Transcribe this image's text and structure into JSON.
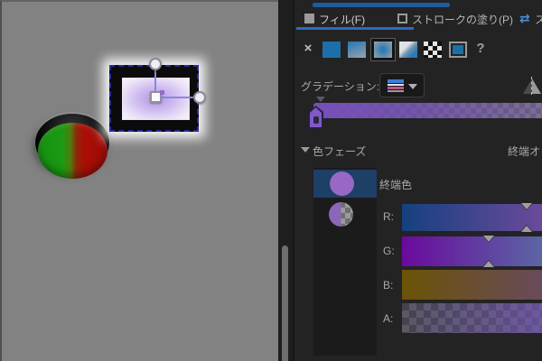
{
  "panel": {
    "tabs": [
      {
        "label": "フィル(F)",
        "active": true
      },
      {
        "label": "ストロークの塗り(P)",
        "active": false
      },
      {
        "label": "ス",
        "active": false
      }
    ],
    "fill_types": {
      "none_label": "×",
      "help_label": "?",
      "selected": "radial-gradient",
      "accent_blue": "#1e6fa8"
    },
    "gradient": {
      "label": "グラデーション:",
      "bar_start": "#7650bb",
      "bar_mid": "rgba(118,80,187,0.78)",
      "bar_end": "rgba(150,120,210,0.38)",
      "stop_color": "#8059c9"
    },
    "color_phase": {
      "section_title": "色フェーズ",
      "end_offset_label": "終端オ",
      "end_color_label": "終端色",
      "selected_row_color": "#1e3f66",
      "stop_swatch_color": "#9768c4"
    },
    "sliders": [
      {
        "label": "R:",
        "from": "#16407f",
        "to": "#6e4a9c",
        "marker": 0.86,
        "checker": false
      },
      {
        "label": "G:",
        "from": "#6a0a9e",
        "to": "#5a69a4",
        "marker": 0.6,
        "checker": false
      },
      {
        "label": "B:",
        "from": "#6b5306",
        "to": "#684a5e",
        "marker": null,
        "checker": false
      },
      {
        "label": "A:",
        "from": "rgba(122,90,200,0.10)",
        "to": "rgba(122,90,200,0.65)",
        "marker": null,
        "checker": true
      }
    ]
  },
  "canvas": {
    "background": "#828282",
    "ellipse": {
      "left_color": "#1d9a12",
      "right_color": "#ab0e07",
      "rim_color": "#0b0b0b"
    },
    "selected_rect": {
      "outer_color": "#0b0b0b",
      "fill_center": "#b495e2",
      "fill_edge": "#f6f3fc"
    }
  }
}
